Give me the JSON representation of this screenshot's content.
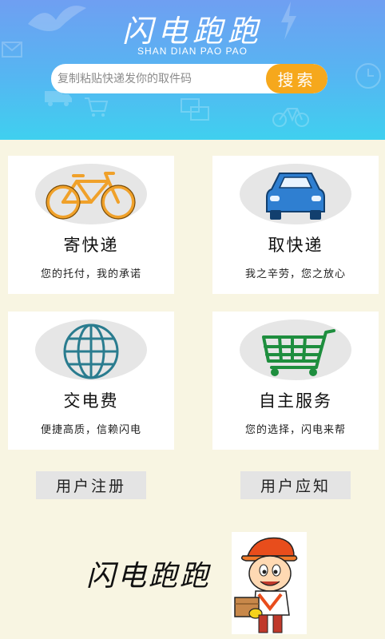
{
  "header": {
    "title": "闪电跑跑",
    "subtitle": "SHAN DIAN PAO PAO"
  },
  "search": {
    "placeholder": "复制粘贴快递发你的取件码",
    "button_label": "搜索"
  },
  "services": [
    {
      "title": "寄快递",
      "desc": "您的托付，我的承诺",
      "icon": "bicycle-icon",
      "icon_color": "#f0a12a"
    },
    {
      "title": "取快递",
      "desc": "我之辛劳，您之放心",
      "icon": "car-icon",
      "icon_color": "#2f7fd1"
    },
    {
      "title": "交电费",
      "desc": "便捷高质，信赖闪电",
      "icon": "globe-icon",
      "icon_color": "#2a7c8f"
    },
    {
      "title": "自主服务",
      "desc": "您的选择，闪电来帮",
      "icon": "shopping-cart-icon",
      "icon_color": "#1e8e3e"
    }
  ],
  "links": {
    "register_label": "用户注册",
    "notice_label": "用户应知"
  },
  "footer": {
    "brand": "闪电跑跑",
    "mascot": "delivery-boy-mascot"
  },
  "colors": {
    "header_top": "#6f9ff2",
    "header_bottom": "#3fd0ef",
    "accent": "#f6a81c",
    "page_bg": "#f8f5e2"
  }
}
